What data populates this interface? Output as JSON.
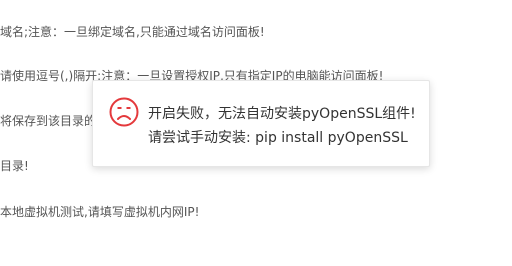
{
  "background": {
    "lines": [
      "域名;注意：一旦绑定域名,只能通过域名访问面板!",
      "请使用逗号(,)隔开;注意：一旦设置授权IP,只有指定IP的电脑能访问面板!",
      "将保存到该目录的下",
      "目录!",
      "本地虚拟机测试,请填写虚拟机内网IP!"
    ]
  },
  "dialog": {
    "icon": "sad-face-icon",
    "icon_color": "#e4393c",
    "line1": "开启失败，无法自动安装pyOpenSSL组件!",
    "line2": "请尝试手动安装: pip install pyOpenSSL"
  }
}
